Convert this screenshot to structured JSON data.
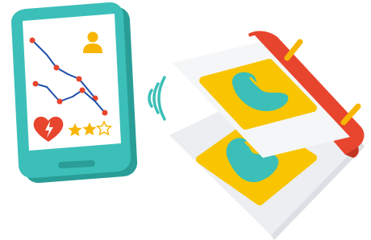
{
  "colors": {
    "phone_body": "#3bbfb8",
    "phone_shadow": "#2a9d97",
    "screen": "#ffffff",
    "line": "#1e4fa8",
    "point": "#e8452e",
    "avatar": "#f7b500",
    "heart": "#e8452e",
    "star": "#f7b500",
    "wifi": "#3bbfb8",
    "card_back": "#e9ebee",
    "card_front": "#f5f6f7",
    "tile": "#f9c500",
    "tile_icon": "#3bbfb8",
    "spine": "#e8452e",
    "ring": "#f7b500"
  },
  "icons": {
    "phone": "tablet-icon",
    "profile": "user-avatar-icon",
    "health": "heart-bolt-icon",
    "rating": "star-rating-icon",
    "signal": "wireless-signal-icon",
    "record": "body-scan-icon"
  },
  "rating": {
    "filled": 2,
    "total": 3
  }
}
